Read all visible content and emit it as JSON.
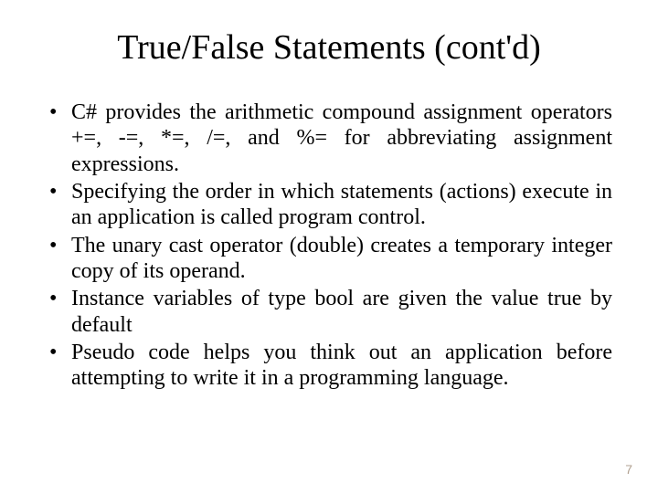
{
  "title": "True/False Statements (cont'd)",
  "bullets": [
    "C# provides the arithmetic compound assignment operators +=, -=, *=, /=, and %= for abbreviating assignment expressions.",
    "Specifying the order in which statements (actions) execute in an application is called program control.",
    "The unary cast operator (double) creates a temporary integer copy of its operand.",
    "Instance variables of type bool are given the value true by default",
    "Pseudo code helps you think out an application before attempting to write it in a programming language."
  ],
  "page_number": "7"
}
